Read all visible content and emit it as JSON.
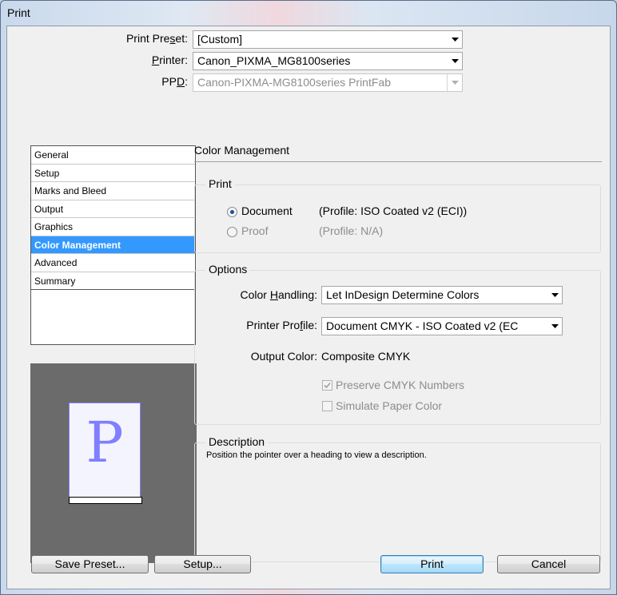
{
  "window": {
    "title": "Print"
  },
  "top": {
    "preset_label": "Print Preset:",
    "preset_value": "[Custom]",
    "printer_label": "Printer:",
    "printer_value": "Canon_PIXMA_MG8100series",
    "ppd_label": "PPD:",
    "ppd_value": "Canon-PIXMA-MG8100series PrintFab"
  },
  "sidebar": {
    "items": [
      {
        "label": "General"
      },
      {
        "label": "Setup"
      },
      {
        "label": "Marks and Bleed"
      },
      {
        "label": "Output"
      },
      {
        "label": "Graphics"
      },
      {
        "label": "Color Management",
        "selected": true
      },
      {
        "label": "Advanced"
      },
      {
        "label": "Summary"
      }
    ]
  },
  "preview": {
    "letter": "P"
  },
  "panel": {
    "heading": "Color Management",
    "print_group": {
      "legend": "Print",
      "document_label": "Document",
      "document_profile": "(Profile: ISO Coated v2 (ECI))",
      "proof_label": "Proof",
      "proof_profile": "(Profile: N/A)",
      "selected": "Document"
    },
    "options_group": {
      "legend": "Options",
      "color_handling_label": "Color Handling:",
      "color_handling_value": "Let InDesign Determine Colors",
      "printer_profile_label": "Printer Profile:",
      "printer_profile_value": "Document CMYK - ISO Coated v2 (EC",
      "output_color_label": "Output Color:",
      "output_color_value": "Composite CMYK",
      "preserve_label": "Preserve CMYK Numbers",
      "preserve_checked": true,
      "simulate_label": "Simulate Paper Color",
      "simulate_checked": false
    },
    "description_group": {
      "legend": "Description",
      "text": "Position the pointer over a heading to view a description."
    }
  },
  "buttons": {
    "save_preset": "Save Preset...",
    "setup": "Setup...",
    "print": "Print",
    "cancel": "Cancel"
  },
  "colors": {
    "selection": "#3399ff",
    "preview_bg": "#6b6b6b",
    "preview_letter": "#7f7fff"
  }
}
